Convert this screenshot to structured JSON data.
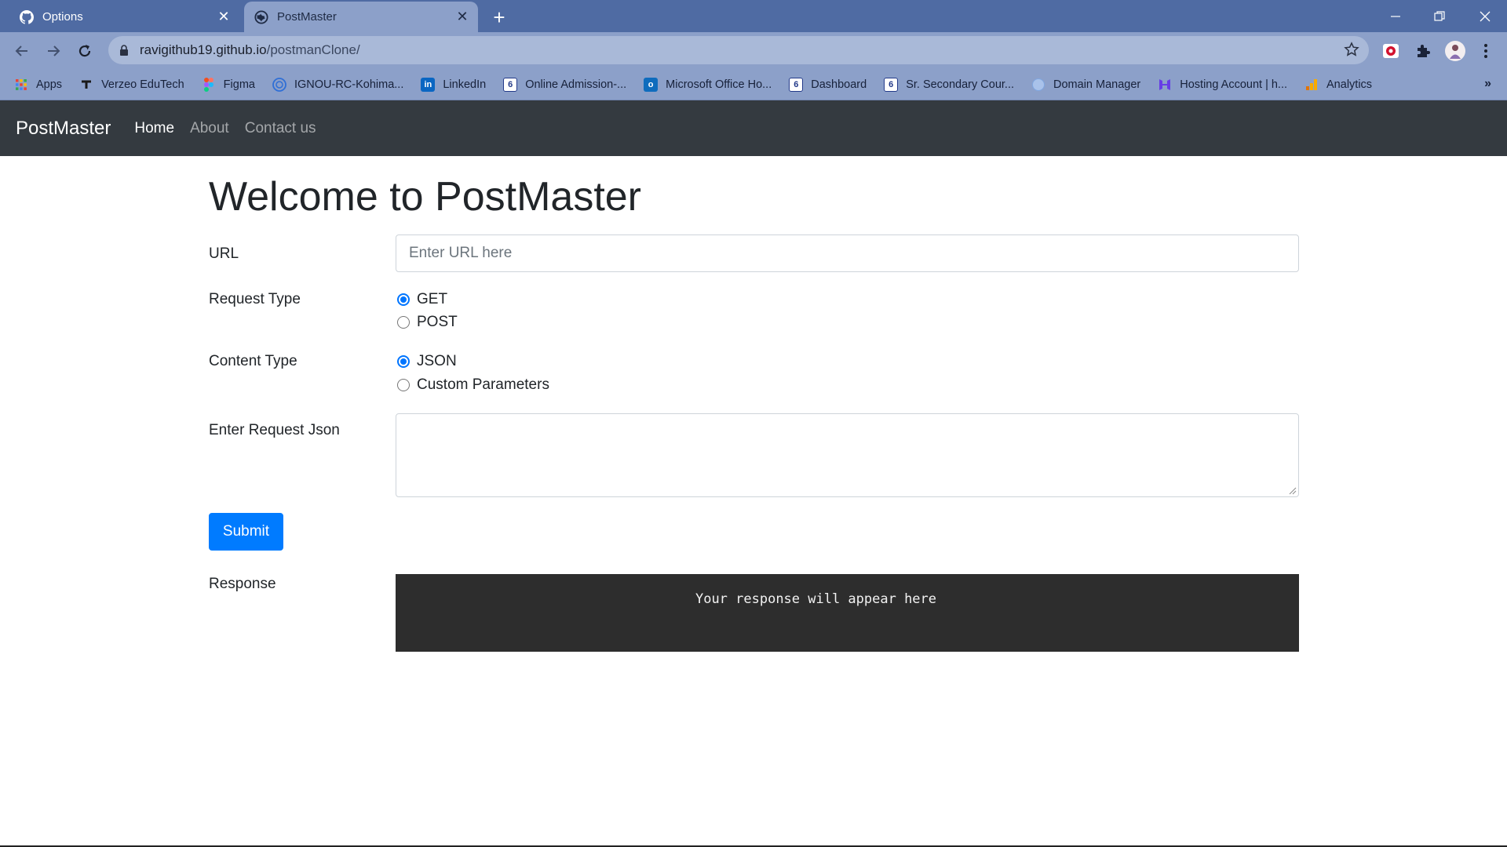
{
  "browser": {
    "tabs": [
      {
        "title": "Options",
        "icon": "github-icon",
        "active": false
      },
      {
        "title": "PostMaster",
        "icon": "globe-icon",
        "active": true
      }
    ],
    "address": {
      "host": "ravigithub19.github.io",
      "path": "/postmanClone/"
    },
    "bookmarks": [
      {
        "label": "Apps",
        "icon": "apps-grid-icon",
        "color": "#e94235"
      },
      {
        "label": "Verzeo EduTech",
        "icon": "verzeo-icon",
        "color": "#222222"
      },
      {
        "label": "Figma",
        "icon": "figma-icon",
        "color": "#a259ff"
      },
      {
        "label": "IGNOU-RC-Kohima...",
        "icon": "ignou-icon",
        "color": "#2f6fd6"
      },
      {
        "label": "LinkedIn",
        "icon": "linkedin-icon",
        "color": "#0a66c2"
      },
      {
        "label": "Online Admission-...",
        "icon": "ignou-logo-icon",
        "color": "#243b8a"
      },
      {
        "label": "Microsoft Office Ho...",
        "icon": "outlook-icon",
        "color": "#0f6cbd"
      },
      {
        "label": "Dashboard",
        "icon": "ignou-logo-icon",
        "color": "#243b8a"
      },
      {
        "label": "Sr. Secondary Cour...",
        "icon": "nios-icon",
        "color": "#243b8a"
      },
      {
        "label": "Domain Manager",
        "icon": "domain-globe-icon",
        "color": "#7fa6e0"
      },
      {
        "label": "Hosting Account | h...",
        "icon": "hostinger-icon",
        "color": "#673de6"
      },
      {
        "label": "Analytics",
        "icon": "analytics-icon",
        "color": "#f9ab00"
      }
    ],
    "more_bookmarks": "»"
  },
  "navbar": {
    "brand": "PostMaster",
    "links": [
      "Home",
      "About",
      "Contact us"
    ]
  },
  "main": {
    "heading": "Welcome to PostMaster",
    "url_label": "URL",
    "url_placeholder": "Enter URL here",
    "request_type_label": "Request Type",
    "request_types": [
      "GET",
      "POST"
    ],
    "request_type_selected": "GET",
    "content_type_label": "Content Type",
    "content_types": [
      "JSON",
      "Custom Parameters"
    ],
    "content_type_selected": "JSON",
    "json_label": "Enter Request Json",
    "submit_label": "Submit",
    "response_label": "Response",
    "response_text": "Your response will appear here"
  },
  "colors": {
    "navbar_bg": "#343a40",
    "primary": "#007bff",
    "response_bg": "#2d2d2d",
    "browser_frame": "#4f6ba3"
  }
}
